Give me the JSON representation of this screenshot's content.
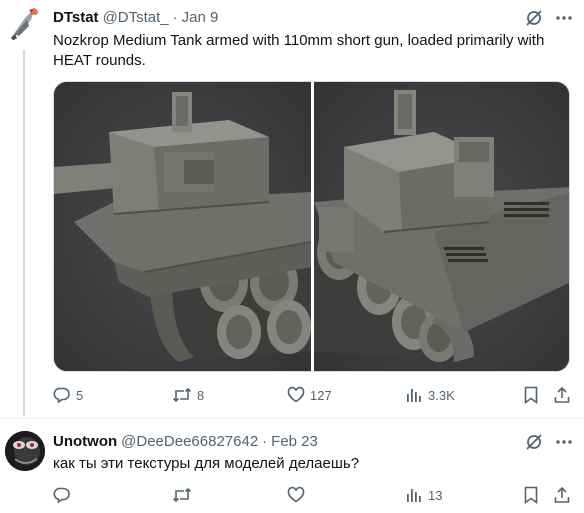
{
  "tweets": [
    {
      "name": "DTstat",
      "handle": "@DTstat_",
      "separator": "·",
      "date": "Jan 9",
      "text": "Nozkrop Medium Tank armed with 110mm short gun, loaded primarily with\nHEAT rounds.",
      "stats": {
        "replies": "5",
        "reposts": "8",
        "likes": "127",
        "views": "3.3K"
      }
    },
    {
      "name": "Unotwon",
      "handle": "@DeeDee66827642",
      "separator": "·",
      "date": "Feb 23",
      "text": "как ты эти текстуры для моделей делаешь?",
      "stats": {
        "replies": "",
        "reposts": "",
        "likes": "",
        "views": "13"
      }
    }
  ],
  "icons": {
    "grok": "grok-icon",
    "more": "more-icon",
    "reply": "reply-icon",
    "repost": "repost-icon",
    "like": "like-icon",
    "views": "views-icon",
    "bookmark": "bookmark-icon",
    "share": "share-icon"
  },
  "colors": {
    "text": "#0f1419",
    "secondary": "#536471",
    "thread": "#cfd9de",
    "media_bg": "#3a3b3c"
  }
}
